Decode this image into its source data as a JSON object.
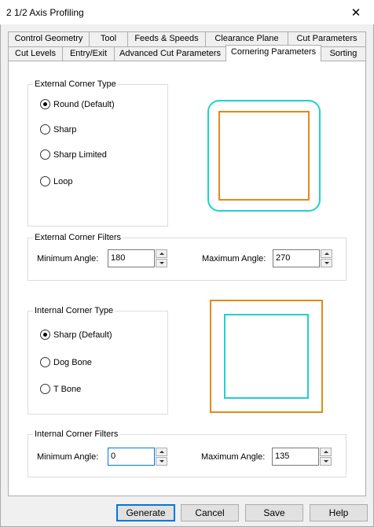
{
  "window": {
    "title": "2 1/2 Axis Profiling",
    "close_glyph": "✕"
  },
  "tabs": {
    "row1": [
      "Control Geometry",
      "Tool",
      "Feeds & Speeds",
      "Clearance Plane",
      "Cut Parameters"
    ],
    "row2": [
      "Cut Levels",
      "Entry/Exit",
      "Advanced Cut Parameters",
      "Cornering Parameters",
      "Sorting"
    ],
    "active": "Cornering Parameters"
  },
  "external_corner_type": {
    "label": "External Corner Type",
    "options": [
      "Round (Default)",
      "Sharp",
      "Sharp Limited",
      "Loop"
    ],
    "selected": "Round (Default)"
  },
  "external_corner_filters": {
    "label": "External Corner Filters",
    "min_label": "Minimum Angle:",
    "min_value": "180",
    "max_label": "Maximum Angle:",
    "max_value": "270"
  },
  "internal_corner_type": {
    "label": "Internal Corner Type",
    "options": [
      "Sharp (Default)",
      "Dog Bone",
      "T Bone"
    ],
    "selected": "Sharp (Default)"
  },
  "internal_corner_filters": {
    "label": "Internal Corner Filters",
    "min_label": "Minimum Angle:",
    "min_value": "0",
    "max_label": "Maximum Angle:",
    "max_value": "135"
  },
  "preview_colors": {
    "outer_path": "#20d0d0",
    "part": "#e08a1a"
  },
  "buttons": {
    "generate": "Generate",
    "cancel": "Cancel",
    "save": "Save",
    "help": "Help"
  }
}
